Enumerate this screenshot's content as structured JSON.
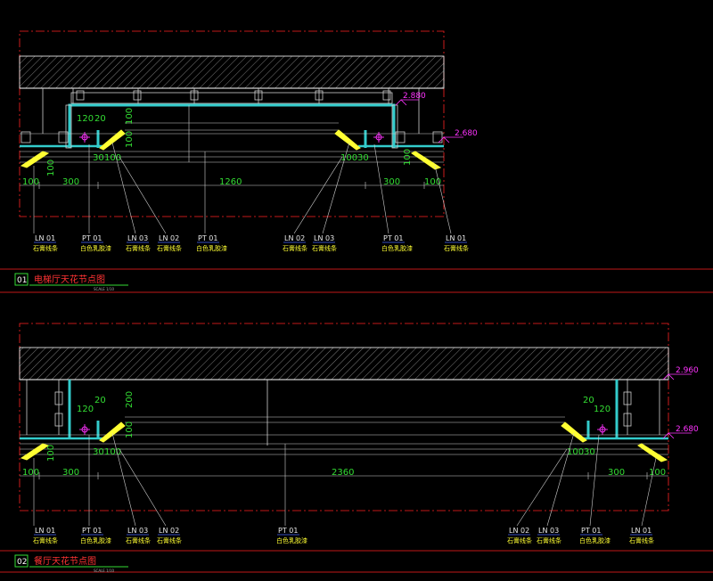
{
  "detail1": {
    "number": "01",
    "title": "电梯厅天花节点图",
    "scale": "SCALE 1/10",
    "levels": [
      "2.880",
      "2.680"
    ],
    "dims_h": [
      "100",
      "300",
      "1260",
      "300",
      "100"
    ],
    "dims_small_left": [
      "30",
      "100"
    ],
    "dims_small_right": [
      "100",
      "30"
    ],
    "dims_top": [
      "120",
      "20",
      "100"
    ],
    "dims_v": [
      "100",
      "100",
      "100"
    ],
    "callouts": [
      {
        "code": "LN 01",
        "material": "石膏线条"
      },
      {
        "code": "PT 01",
        "material": "白色乳胶漆"
      },
      {
        "code": "LN 03",
        "material": "石膏线条"
      },
      {
        "code": "LN 02",
        "material": "石膏线条"
      },
      {
        "code": "PT 01",
        "material": "白色乳胶漆"
      },
      {
        "code": "LN 02",
        "material": "石膏线条"
      },
      {
        "code": "LN 03",
        "material": "石膏线条"
      },
      {
        "code": "PT 01",
        "material": "白色乳胶漆"
      },
      {
        "code": "LN 01",
        "material": "石膏线条"
      }
    ]
  },
  "detail2": {
    "number": "02",
    "title": "餐厅天花节点图",
    "scale": "SCALE 1/10",
    "levels": [
      "2.960",
      "2.680"
    ],
    "dims_h": [
      "100",
      "300",
      "2360",
      "300",
      "100"
    ],
    "dims_small_left": [
      "30",
      "100"
    ],
    "dims_small_right": [
      "100",
      "30"
    ],
    "dims_top_left": [
      "20",
      "120"
    ],
    "dims_top_right": [
      "20",
      "120"
    ],
    "dims_v": [
      "200",
      "100",
      "100"
    ],
    "callouts": [
      {
        "code": "LN 01",
        "material": "石膏线条"
      },
      {
        "code": "PT 01",
        "material": "白色乳胶漆"
      },
      {
        "code": "LN 03",
        "material": "石膏线条"
      },
      {
        "code": "LN 02",
        "material": "石膏线条"
      },
      {
        "code": "PT 01",
        "material": "白色乳胶漆"
      },
      {
        "code": "LN 02",
        "material": "石膏线条"
      },
      {
        "code": "LN 03",
        "material": "石膏线条"
      },
      {
        "code": "PT 01",
        "material": "白色乳胶漆"
      },
      {
        "code": "LN 01",
        "material": "石膏线条"
      }
    ]
  },
  "colors": {
    "background": "#000000",
    "frame": "#ff2222",
    "structure": "#ffffff",
    "board": "#33cccc",
    "dimension": "#33dd33",
    "level": "#ff33ff",
    "material": "#ffff33",
    "title_underline": "#33dd33"
  }
}
